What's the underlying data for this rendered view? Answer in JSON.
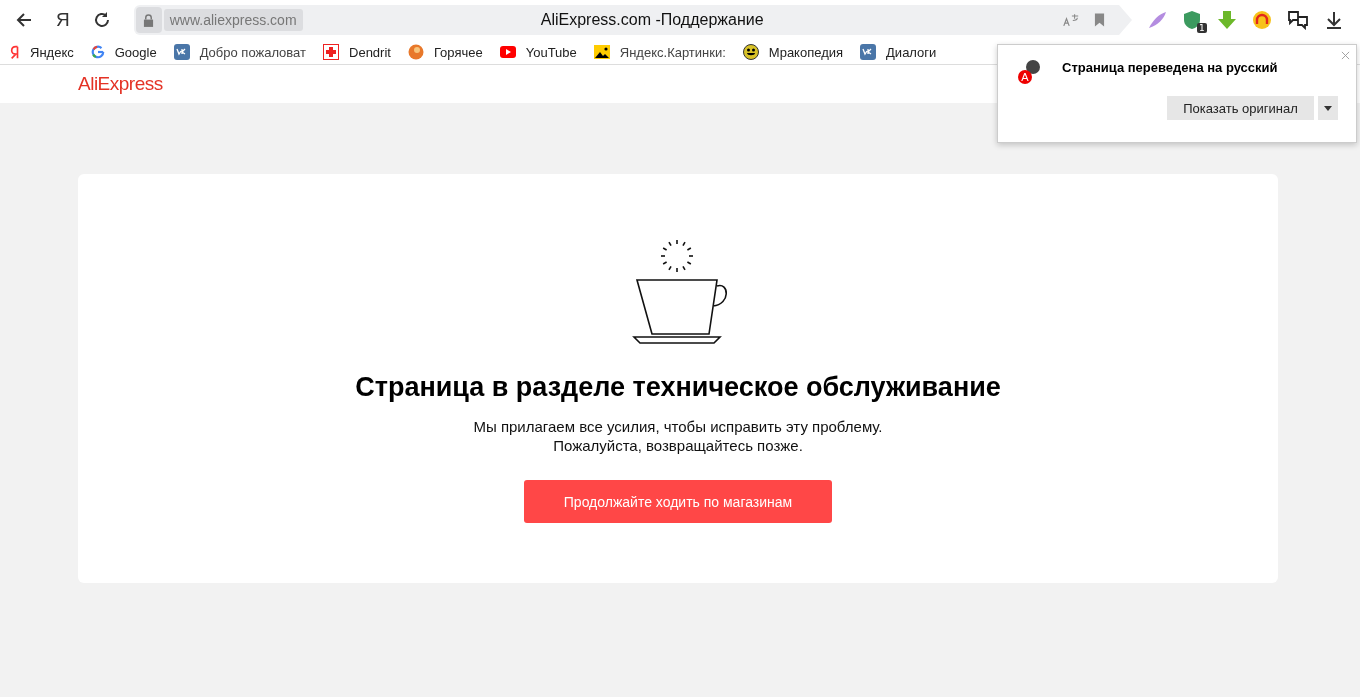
{
  "browser": {
    "yandex_button": "Я",
    "address": "www.aliexpress.com",
    "title": "AliExpress.com -Поддержание",
    "extension_badge": "1"
  },
  "bookmarks": [
    {
      "label": "Яндекс",
      "kind": "yandex"
    },
    {
      "label": "Google",
      "kind": "google"
    },
    {
      "label": "Добро пожаловат",
      "kind": "vk"
    },
    {
      "label": "Dendrit",
      "kind": "cross"
    },
    {
      "label": "Горячее",
      "kind": "ball"
    },
    {
      "label": "YouTube",
      "kind": "youtube"
    },
    {
      "label": "Яндекс.Картинки:",
      "kind": "image"
    },
    {
      "label": "Мракопедия",
      "kind": "smiley"
    },
    {
      "label": "Диалоги",
      "kind": "vk"
    }
  ],
  "site": {
    "logo": "AliExpress"
  },
  "notice": {
    "title": "Страница в разделе техническое обслуживание",
    "lines": [
      "Мы прилагаем все усилия, чтобы исправить эту проблему.",
      "Пожалуйста, возвращайтесь позже."
    ],
    "button": "Продолжайте ходить по магазинам"
  },
  "translate_popup": {
    "message": "Страница переведена на русский",
    "button": "Показать оригинал",
    "badge": "A"
  }
}
